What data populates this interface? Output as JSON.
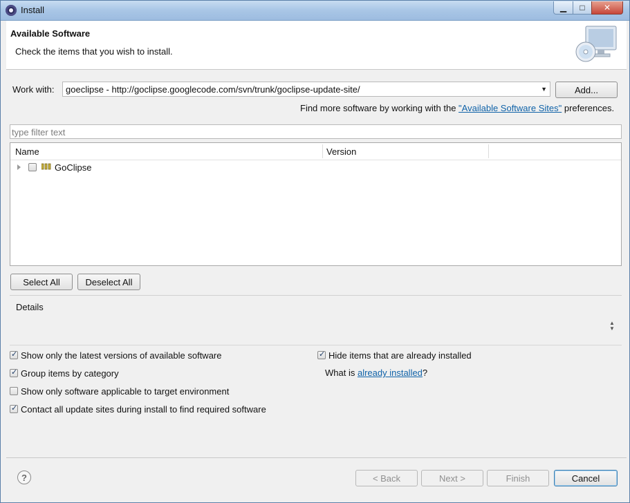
{
  "window": {
    "title": "Install",
    "icon": "eclipse-icon"
  },
  "header": {
    "title": "Available Software",
    "subtitle": "Check the items that you wish to install.",
    "image": "install-cd-monitor-icon"
  },
  "work_with": {
    "label": "Work with:",
    "value": "goeclipse - http://goclipse.googlecode.com/svn/trunk/goclipse-update-site/",
    "add_label": "Add..."
  },
  "sites_hint": {
    "prefix": "Find more software by working with the ",
    "link": "\"Available Software Sites\"",
    "suffix": " preferences."
  },
  "filter": {
    "placeholder": "type filter text"
  },
  "tree": {
    "columns": [
      "Name",
      "Version"
    ],
    "items": [
      {
        "name": "GoClipse",
        "version": "",
        "checked": false,
        "expanded": false
      }
    ]
  },
  "buttons": {
    "select_all": "Select All",
    "deselect_all": "Deselect All"
  },
  "details": {
    "label": "Details"
  },
  "options": {
    "latest": {
      "label": "Show only the latest versions of available software",
      "checked": true
    },
    "group": {
      "label": "Group items by category",
      "checked": true
    },
    "applicable": {
      "label": "Show only software applicable to target environment",
      "checked": false
    },
    "contact": {
      "label": "Contact all update sites during install to find required software",
      "checked": true
    },
    "hide_installed": {
      "label": "Hide items that are already installed",
      "checked": true
    },
    "what_is": {
      "prefix": "What is ",
      "link": "already installed",
      "suffix": "?"
    }
  },
  "footer": {
    "back": "< Back",
    "next": "Next >",
    "finish": "Finish",
    "cancel": "Cancel",
    "help_icon": "help-icon"
  }
}
